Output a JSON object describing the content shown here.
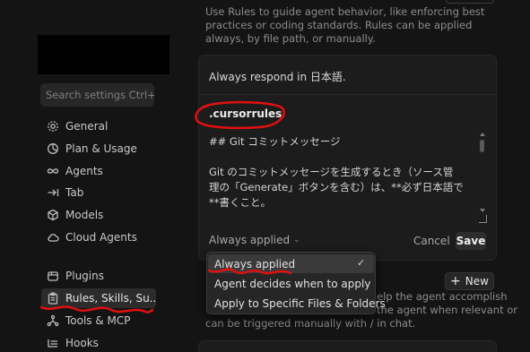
{
  "sidebar": {
    "search_placeholder": "Search settings Ctrl+F",
    "items": [
      {
        "label": "General",
        "icon": "gear-icon"
      },
      {
        "label": "Plan & Usage",
        "icon": "chart-icon"
      },
      {
        "label": "Agents",
        "icon": "infinity-icon"
      },
      {
        "label": "Tab",
        "icon": "tab-arrow-icon"
      },
      {
        "label": "Models",
        "icon": "cube-icon"
      },
      {
        "label": "Cloud Agents",
        "icon": "cloud-icon"
      },
      {
        "label": "Plugins",
        "icon": "package-icon"
      },
      {
        "label": "Rules, Skills, Su...",
        "icon": "clipboard-icon"
      },
      {
        "label": "Tools & MCP",
        "icon": "network-icon"
      },
      {
        "label": "Hooks",
        "icon": "list-icon"
      }
    ]
  },
  "main": {
    "intro": "Use Rules to guide agent behavior, like enforcing best practices or coding standards. Rules can be applied always, by file path, or manually.",
    "card": {
      "user_rule": "Always respond in 日本語.",
      "file_name": ".cursorrules",
      "editor_lines": [
        "## Git コミットメッセージ",
        "",
        "Git のコミットメッセージを生成するとき（ソース管",
        "理の「Generate」ボタンを含む）は、**必ず日本語で",
        "**書くこと。",
        "",
        "---"
      ],
      "mode_label": "Always applied",
      "cancel_label": "Cancel",
      "save_label": "Save"
    },
    "dropdown": {
      "options": [
        "Always applied",
        "Agent decides when to apply",
        "Apply to Specific Files & Folders"
      ],
      "selected": "Always applied"
    },
    "new_button_label": "New",
    "lower_text_lines": [
      "elp the agent accomplish",
      "the agent when relevant or"
    ],
    "lower_text_line3": "can be triggered manually with / in chat."
  },
  "colors": {
    "background": "#141414",
    "card": "#1c1c1c",
    "annotation_red": "#e01010"
  }
}
